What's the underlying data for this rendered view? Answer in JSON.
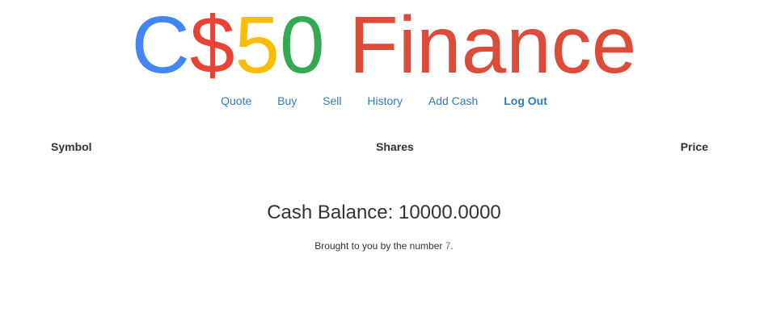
{
  "logo": {
    "letters": [
      {
        "char": "C",
        "color": "#4285f4"
      },
      {
        "char": "$",
        "color": "#ea4335"
      },
      {
        "char": "5",
        "color": "#fbbc05"
      },
      {
        "char": "0",
        "color": "#34a853"
      }
    ],
    "word": "Finance",
    "word_color": "#dd4b39"
  },
  "nav": {
    "quote": "Quote",
    "buy": "Buy",
    "sell": "Sell",
    "history": "History",
    "add_cash": "Add Cash",
    "logout": "Log Out"
  },
  "portfolio": {
    "headers": [
      "Symbol",
      "Shares",
      "Price"
    ],
    "rows": []
  },
  "cash": {
    "text": "Cash Balance: 10000.0000"
  },
  "footer": {
    "prefix": "Brought to you by the number ",
    "number": "7",
    "suffix": "."
  },
  "colors": {
    "link": "#337ab7",
    "text": "#333333"
  }
}
